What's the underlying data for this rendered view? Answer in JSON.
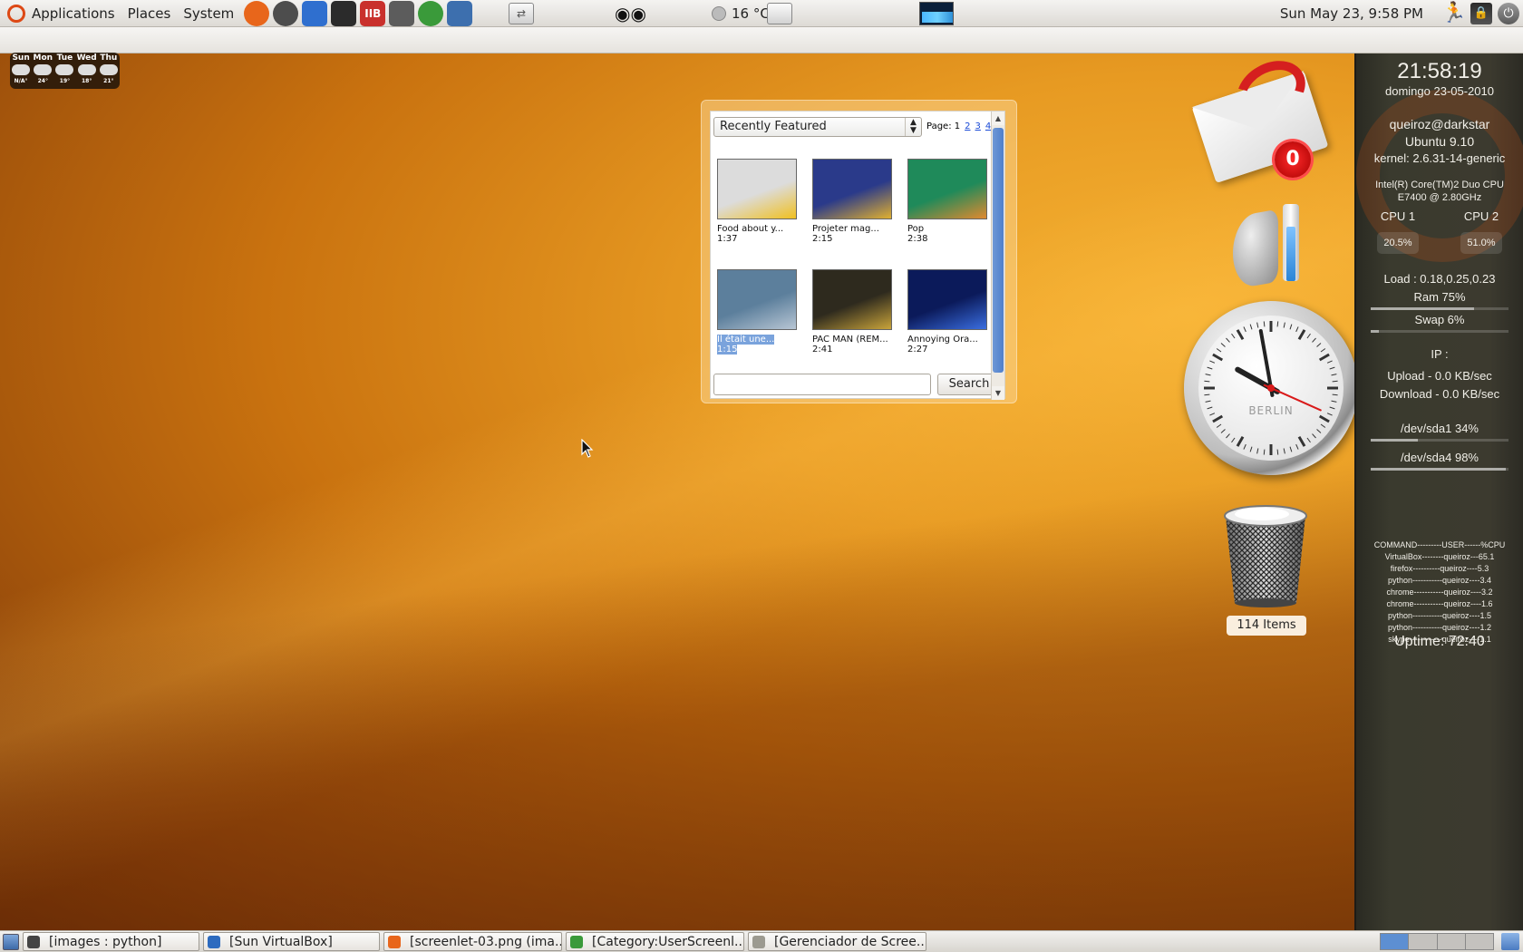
{
  "top_panel": {
    "menus": [
      "Applications",
      "Places",
      "System"
    ],
    "launchers": [
      {
        "icon": "firefox-icon",
        "color": "#e8661b"
      },
      {
        "icon": "rhythmbox-icon",
        "color": "#4d4d4d"
      },
      {
        "icon": "bird-icon",
        "color": "#2f6fcf"
      },
      {
        "icon": "terminal-icon",
        "color": "#2b2b2b"
      },
      {
        "icon": "text-editor-icon",
        "color": "#c9302c",
        "text": "IIB"
      },
      {
        "icon": "calculator-icon",
        "color": "#5c5c5c"
      },
      {
        "icon": "chrome-icon",
        "color": "#3a9a3a"
      },
      {
        "icon": "file-manager-icon",
        "color": "#3d6fae"
      }
    ],
    "temperature": "16 °C",
    "datetime": "Sun May 23,  9:58 PM"
  },
  "weather": {
    "days": [
      {
        "day": "Sun",
        "temps": "N/A°"
      },
      {
        "day": "Mon",
        "temps": "24°"
      },
      {
        "day": "Tue",
        "temps": "19°"
      },
      {
        "day": "Wed",
        "temps": "18°"
      },
      {
        "day": "Thu",
        "temps": "21°"
      }
    ]
  },
  "video_widget": {
    "feed": "Recently Featured",
    "page_label": "Page: 1",
    "pages": [
      "2",
      "3",
      "4"
    ],
    "videos": [
      {
        "title": "Food about y...",
        "duration": "1:37",
        "thumb": "#dcdcdc",
        "accent": "#f0c020"
      },
      {
        "title": "Projeter mag...",
        "duration": "2:15",
        "thumb": "#2a3a8a",
        "accent": "#e0b030"
      },
      {
        "title": "Pop",
        "duration": "2:38",
        "thumb": "#1f8a5a",
        "accent": "#e08a30"
      },
      {
        "title": "Il était une...",
        "duration": "1:15",
        "thumb": "#5c7f9c",
        "accent": "#b8c6d4",
        "selected": true
      },
      {
        "title": "PAC MAN (REM...",
        "duration": "2:41",
        "thumb": "#2e2a1e",
        "accent": "#c9a43a"
      },
      {
        "title": "Annoying Ora...",
        "duration": "2:27",
        "thumb": "#0b1a5a",
        "accent": "#3a6ee0"
      }
    ],
    "search_value": "",
    "search_label": "Search"
  },
  "mail": {
    "count": "0"
  },
  "volume": {
    "level": 0.8
  },
  "clock": {
    "city": "BERLIN",
    "hours": 21,
    "minutes": 58,
    "seconds": 19
  },
  "trash": {
    "label": "114 Items"
  },
  "sysmon": {
    "time": "21:58:19",
    "date": "domingo 23-05-2010",
    "user": "queiroz@darkstar",
    "os": "Ubuntu 9.10",
    "kernel": "kernel: 2.6.31-14-generic",
    "cpu_model": "Intel(R) Core(TM)2 Duo CPU",
    "cpu_speed": "E7400  @ 2.80GHz",
    "cpu1_label": "CPU 1",
    "cpu2_label": "CPU 2",
    "cpu1_value": "20.5%",
    "cpu2_value": "51.0%",
    "load": "Load : 0.18,0.25,0.23",
    "ram": "Ram 75%",
    "ram_level": 0.75,
    "swap": "Swap 6%",
    "swap_level": 0.06,
    "ip": "IP :",
    "upload": "Upload - 0.0 KB/sec",
    "download": "Download - 0.0 KB/sec",
    "sda1": "/dev/sda1 34%",
    "sda1_level": 0.34,
    "sda4": "/dev/sda4 98%",
    "sda4_level": 0.98,
    "process_header": "COMMAND---------USER------%CPU",
    "processes": [
      "VirtualBox--------queiroz---65.1",
      "firefox----------queiroz----5.3",
      "python-----------queiroz----3.4",
      "chrome-----------queiroz----3.2",
      "chrome-----------queiroz----1.6",
      "python-----------queiroz----1.5",
      "python-----------queiroz----1.2",
      "skype------------queiroz----1.1"
    ],
    "uptime": "Uptime: 72:40"
  },
  "taskbar": {
    "tasks": [
      {
        "label": "[images : python]",
        "icon": "terminal-icon",
        "color": "#444"
      },
      {
        "label": "[Sun VirtualBox]",
        "icon": "virtualbox-icon",
        "color": "#2d6bbf"
      },
      {
        "label": "[screenlet-03.png (ima...",
        "icon": "firefox-icon",
        "color": "#e8661b"
      },
      {
        "label": "[Category:UserScreenl...",
        "icon": "chrome-icon",
        "color": "#3a9a3a"
      },
      {
        "label": "[Gerenciador de Scree...",
        "icon": "screenlets-icon",
        "color": "#9c9a90"
      }
    ]
  }
}
